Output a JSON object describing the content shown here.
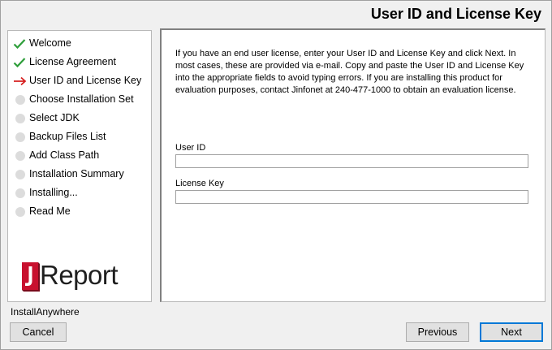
{
  "header": {
    "title": "User ID and License Key"
  },
  "steps": [
    {
      "label": "Welcome",
      "status": "done"
    },
    {
      "label": "License Agreement",
      "status": "done"
    },
    {
      "label": "User ID and License Key",
      "status": "current"
    },
    {
      "label": "Choose Installation Set",
      "status": "pending"
    },
    {
      "label": "Select JDK",
      "status": "pending"
    },
    {
      "label": "Backup Files List",
      "status": "pending"
    },
    {
      "label": "Add Class Path",
      "status": "pending"
    },
    {
      "label": "Installation Summary",
      "status": "pending"
    },
    {
      "label": "Installing...",
      "status": "pending"
    },
    {
      "label": "Read Me",
      "status": "pending"
    }
  ],
  "logo": {
    "mark": "J",
    "text": "Report"
  },
  "content": {
    "instructions": "If you have an end user license, enter your User ID and License Key and click Next. In most cases, these are provided via e-mail. Copy and paste the User ID and License Key into the appropriate fields to avoid typing errors. If you are installing this product for evaluation purposes, contact Jinfonet at 240-477-1000 to obtain an evaluation license.",
    "user_id_label": "User ID",
    "user_id_value": "",
    "license_key_label": "License Key",
    "license_key_value": ""
  },
  "footer": {
    "brand": "InstallAnywhere",
    "cancel_label": "Cancel",
    "previous_label": "Previous",
    "next_label": "Next"
  },
  "colors": {
    "check": "#2e9e3a",
    "arrow": "#d62020",
    "logo_red": "#c8102e",
    "pending_dot": "#dcdcdc",
    "focus": "#0078d7"
  },
  "icons": {
    "done": "checkmark-icon",
    "current": "arrow-right-icon",
    "pending": "circle-icon"
  }
}
